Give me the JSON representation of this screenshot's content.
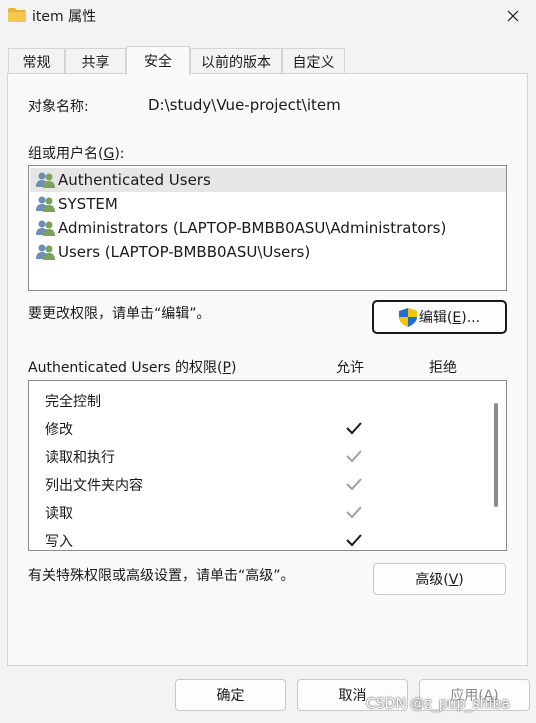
{
  "window": {
    "title": "item 属性",
    "close_icon": "close-icon"
  },
  "tabs": [
    {
      "label": "常规",
      "active": false
    },
    {
      "label": "共享",
      "active": false
    },
    {
      "label": "安全",
      "active": true
    },
    {
      "label": "以前的版本",
      "active": false
    },
    {
      "label": "自定义",
      "active": false
    }
  ],
  "security": {
    "object_name_label": "对象名称:",
    "object_name_value": "D:\\study\\Vue-project\\item",
    "groups_label_pre": "组或用户名(",
    "groups_label_key": "G",
    "groups_label_post": "):",
    "groups": [
      {
        "name": "Authenticated Users",
        "selected": true
      },
      {
        "name": "SYSTEM",
        "selected": false
      },
      {
        "name": "Administrators (LAPTOP-BMBB0ASU\\Administrators)",
        "selected": false
      },
      {
        "name": "Users (LAPTOP-BMBB0ASU\\Users)",
        "selected": false
      }
    ],
    "edit_hint": "要更改权限，请单击“编辑”。",
    "edit_button_pre": "编辑(",
    "edit_button_key": "E",
    "edit_button_post": ")...",
    "perm_label_pre": "Authenticated Users 的权限(",
    "perm_label_key": "P",
    "perm_label_post": ")",
    "allow_header": "允许",
    "deny_header": "拒绝",
    "permissions": [
      {
        "name": "完全控制",
        "allow": "none"
      },
      {
        "name": "修改",
        "allow": "checked"
      },
      {
        "name": "读取和执行",
        "allow": "inherited"
      },
      {
        "name": "列出文件夹内容",
        "allow": "inherited"
      },
      {
        "name": "读取",
        "allow": "inherited"
      },
      {
        "name": "写入",
        "allow": "checked"
      }
    ],
    "advanced_hint": "有关特殊权限或高级设置，请单击“高级”。",
    "advanced_button_pre": "高级(",
    "advanced_button_key": "V",
    "advanced_button_post": ")"
  },
  "footer": {
    "ok_label": "确定",
    "cancel_label": "取消",
    "apply_pre": "应用(",
    "apply_key": "A",
    "apply_post": ")"
  },
  "watermark": "CSDN @z_pup_shiba",
  "colors": {
    "check_dark": "#1a1a1a",
    "check_inherited": "#a0a0a0",
    "shield_blue": "#1f6fd1",
    "shield_yellow": "#f5c400",
    "folder": "#e8b33c"
  }
}
